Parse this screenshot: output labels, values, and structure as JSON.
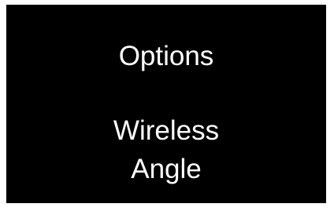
{
  "screen": {
    "title": "Options",
    "items": [
      {
        "label": "Wireless"
      },
      {
        "label": "Angle"
      }
    ]
  },
  "colors": {
    "background": "#000000",
    "text": "#ffffff",
    "border": "#ffffff"
  }
}
